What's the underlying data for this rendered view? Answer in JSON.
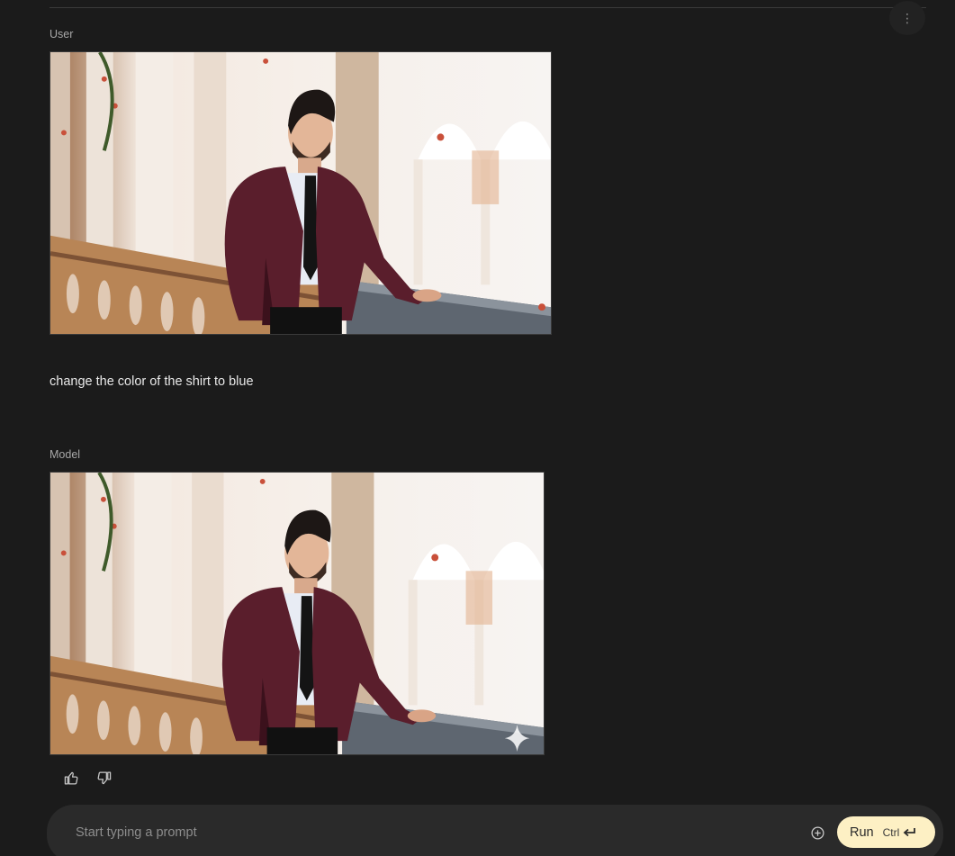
{
  "menu": {
    "icon": "more-vert-icon",
    "glyph": "⋮"
  },
  "turns": [
    {
      "role": "User",
      "image": {
        "subject": "man in burgundy blazer leaning on balcony railing"
      },
      "text": "change the color of the shirt to blue"
    },
    {
      "role": "Model",
      "image": {
        "subject": "man in burgundy blazer leaning on balcony railing"
      },
      "watermark_icon": "sparkle-icon"
    }
  ],
  "feedback": {
    "up_icon": "thumb-up-icon",
    "down_icon": "thumb-down-icon"
  },
  "composer": {
    "placeholder": "Start typing a prompt",
    "value": "",
    "add_icon": "add-circle-icon",
    "run_label": "Run",
    "run_shortcut": "Ctrl",
    "enter_icon": "enter-icon"
  },
  "colors": {
    "background": "#1b1b1b",
    "composer": "#2a2a2a",
    "run_button": "#fdf0c4",
    "blazer": "#5a1e2c"
  }
}
